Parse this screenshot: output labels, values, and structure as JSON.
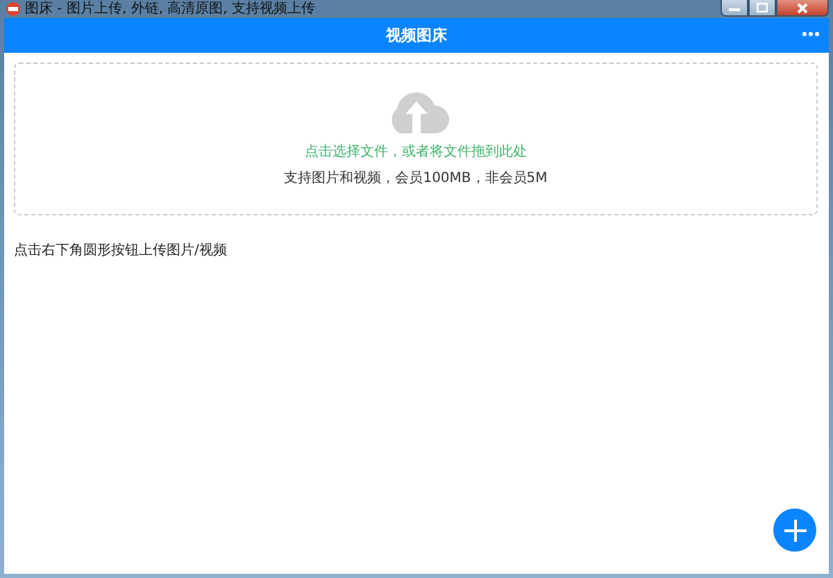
{
  "window": {
    "title": "图床 - 图片上传, 外链, 高清原图, 支持视频上传"
  },
  "header": {
    "title": "视频图床"
  },
  "dropzone": {
    "prompt": "点击选择文件，或者将文件拖到此处",
    "note": "支持图片和视频，会员100MB，非会员5M"
  },
  "hint": "点击右下角圆形按钮上传图片/视频"
}
